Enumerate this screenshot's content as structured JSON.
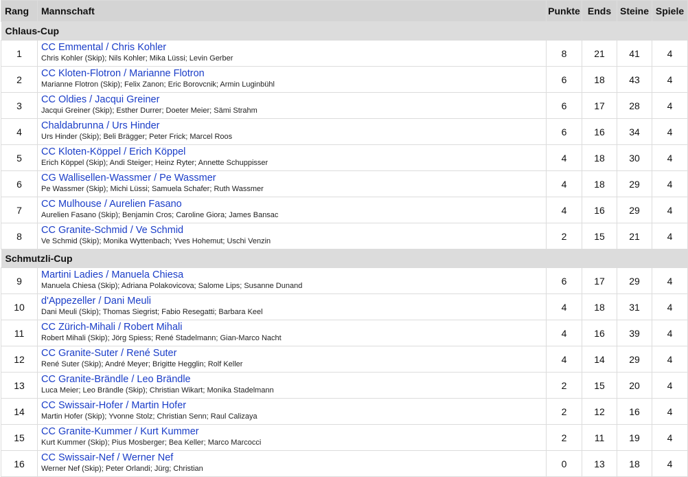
{
  "columns": {
    "rank": "Rang",
    "team": "Mannschaft",
    "points": "Punkte",
    "ends": "Ends",
    "stones": "Steine",
    "games": "Spiele"
  },
  "groups": [
    {
      "name": "Chlaus-Cup",
      "rows": [
        {
          "rank": "1",
          "team": "CC Emmental / Chris Kohler",
          "members": "Chris Kohler (Skip); Nils Kohler; Mika Lüssi; Levin Gerber",
          "points": "8",
          "ends": "21",
          "stones": "41",
          "games": "4"
        },
        {
          "rank": "2",
          "team": "CC Kloten-Flotron / Marianne Flotron",
          "members": "Marianne Flotron (Skip); Felix Zanon; Eric Borovcnik; Armin Luginbühl",
          "points": "6",
          "ends": "18",
          "stones": "43",
          "games": "4"
        },
        {
          "rank": "3",
          "team": "CC Oldies / Jacqui Greiner",
          "members": "Jacqui Greiner (Skip); Esther Durrer; Doeter Meier; Sämi Strahm",
          "points": "6",
          "ends": "17",
          "stones": "28",
          "games": "4"
        },
        {
          "rank": "4",
          "team": "Chaldabrunna / Urs Hinder",
          "members": "Urs Hinder (Skip); Beli Brägger; Peter Frick; Marcel Roos",
          "points": "6",
          "ends": "16",
          "stones": "34",
          "games": "4"
        },
        {
          "rank": "5",
          "team": "CC Kloten-Köppel / Erich Köppel",
          "members": "Erich Köppel (Skip); Andi Steiger; Heinz Ryter; Annette Schuppisser",
          "points": "4",
          "ends": "18",
          "stones": "30",
          "games": "4"
        },
        {
          "rank": "6",
          "team": "CG Wallisellen-Wassmer / Pe Wassmer",
          "members": "Pe Wassmer (Skip); Michi Lüssi; Samuela Schafer; Ruth Wassmer",
          "points": "4",
          "ends": "18",
          "stones": "29",
          "games": "4"
        },
        {
          "rank": "7",
          "team": "CC Mulhouse / Aurelien Fasano",
          "members": "Aurelien Fasano (Skip); Benjamin Cros; Caroline Giora; James Bansac",
          "points": "4",
          "ends": "16",
          "stones": "29",
          "games": "4"
        },
        {
          "rank": "8",
          "team": "CC Granite-Schmid / Ve Schmid",
          "members": "Ve Schmid (Skip); Monika Wyttenbach; Yves Hohemut; Uschi Venzin",
          "points": "2",
          "ends": "15",
          "stones": "21",
          "games": "4"
        }
      ]
    },
    {
      "name": "Schmutzli-Cup",
      "rows": [
        {
          "rank": "9",
          "team": "Martini Ladies / Manuela Chiesa",
          "members": "Manuela Chiesa (Skip); Adriana Polakovicova; Salome Lips; Susanne Dunand",
          "points": "6",
          "ends": "17",
          "stones": "29",
          "games": "4"
        },
        {
          "rank": "10",
          "team": "d'Appezeller / Dani Meuli",
          "members": "Dani Meuli (Skip); Thomas Siegrist; Fabio Resegatti; Barbara Keel",
          "points": "4",
          "ends": "18",
          "stones": "31",
          "games": "4"
        },
        {
          "rank": "11",
          "team": "CC Zürich-Mihali / Robert Mihali",
          "members": "Robert Mihali (Skip); Jörg Spiess; René Stadelmann; Gian-Marco Nacht",
          "points": "4",
          "ends": "16",
          "stones": "39",
          "games": "4"
        },
        {
          "rank": "12",
          "team": "CC Granite-Suter / René Suter",
          "members": "René Suter (Skip); André Meyer; Brigitte Hegglin; Rolf Keller",
          "points": "4",
          "ends": "14",
          "stones": "29",
          "games": "4"
        },
        {
          "rank": "13",
          "team": "CC Granite-Brändle / Leo Brändle",
          "members": "Luca Meier; Leo Brändle (Skip); Christian Wikart; Monika Stadelmann",
          "points": "2",
          "ends": "15",
          "stones": "20",
          "games": "4"
        },
        {
          "rank": "14",
          "team": "CC Swissair-Hofer / Martin Hofer",
          "members": "Martin Hofer (Skip); Yvonne Stolz; Christian Senn; Raul Calizaya",
          "points": "2",
          "ends": "12",
          "stones": "16",
          "games": "4"
        },
        {
          "rank": "15",
          "team": "CC Granite-Kummer / Kurt Kummer",
          "members": "Kurt Kummer (Skip); Pius Mosberger; Bea Keller; Marco Marcocci",
          "points": "2",
          "ends": "11",
          "stones": "19",
          "games": "4"
        },
        {
          "rank": "16",
          "team": "CC Swissair-Nef / Werner Nef",
          "members": "Werner Nef (Skip); Peter Orlandi; Jürg; Christian",
          "points": "0",
          "ends": "13",
          "stones": "18",
          "games": "4"
        }
      ]
    }
  ]
}
